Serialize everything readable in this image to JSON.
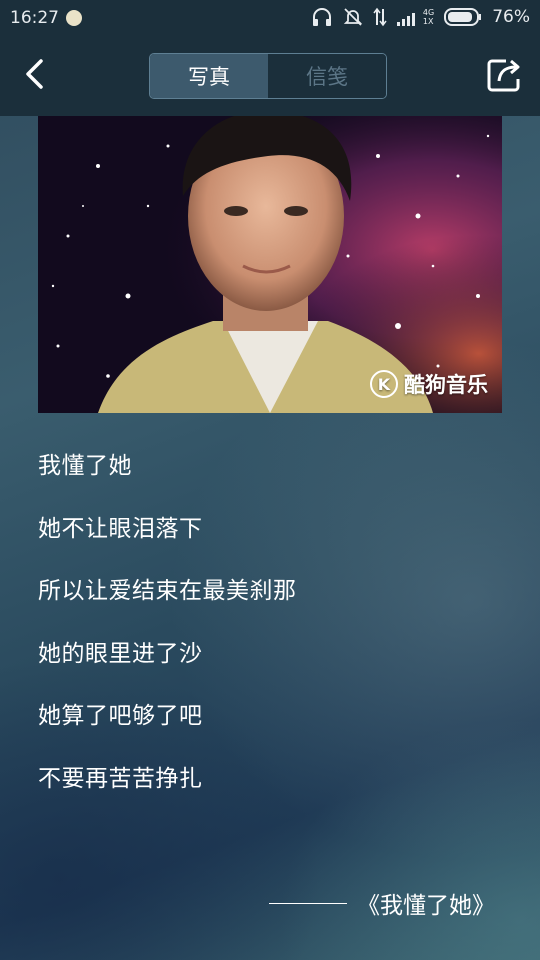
{
  "status_bar": {
    "time": "16:27",
    "network": "4G",
    "network_sub": "1X",
    "battery": "76%"
  },
  "header": {
    "back_icon": "chevron-left-icon",
    "tabs": [
      {
        "label": "写真",
        "active": true
      },
      {
        "label": "信笺",
        "active": false
      }
    ],
    "share_icon": "share-icon"
  },
  "photo": {
    "watermark_logo": "K",
    "watermark_text": "酷狗音乐"
  },
  "lyrics": [
    "我懂了她",
    "她不让眼泪落下",
    "所以让爱结束在最美刹那",
    "她的眼里进了沙",
    "她算了吧够了吧",
    "不要再苦苦挣扎"
  ],
  "song_credit": "《我懂了她》",
  "colors": {
    "header_bg": "#1b2f3b",
    "tab_active_bg": "#3d5a6d",
    "tab_inactive_text": "#5c7687"
  }
}
